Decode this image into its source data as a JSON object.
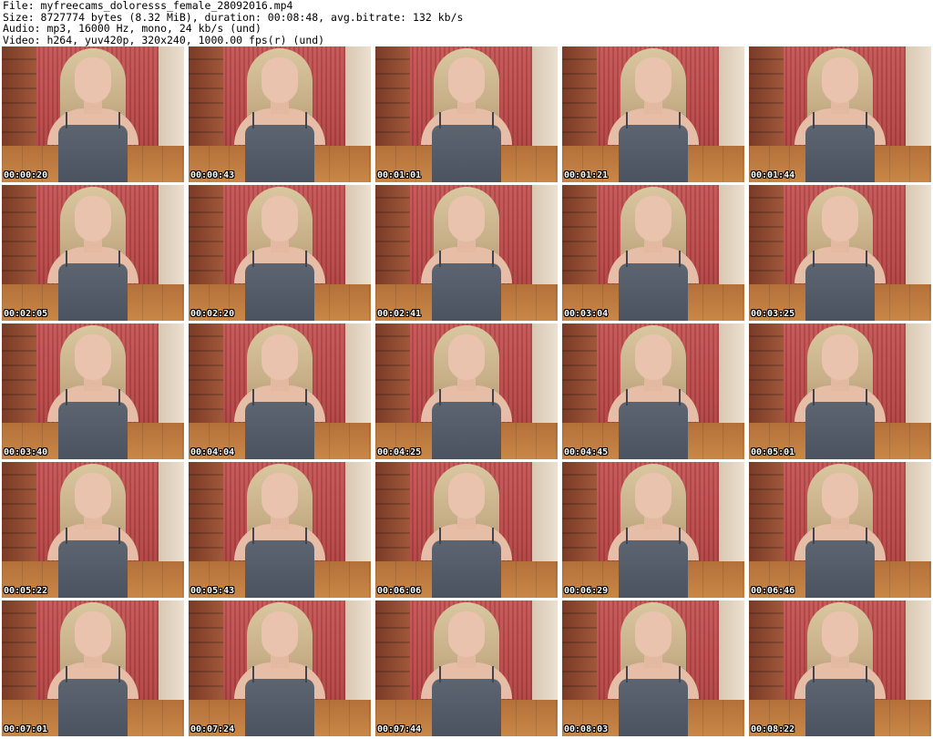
{
  "header": {
    "file_line": "File: myfreecams_doloresss_female_28092016.mp4",
    "size_line": "Size: 8727774 bytes (8.32 MiB), duration: 00:08:48, avg.bitrate: 132 kb/s",
    "audio_line": "Audio: mp3, 16000 Hz, mono, 24 kb/s (und)",
    "video_line": "Video: h264, yuv420p, 320x240, 1000.00 fps(r) (und)"
  },
  "thumbnails": [
    {
      "timestamp": "00:00:20"
    },
    {
      "timestamp": "00:00:43"
    },
    {
      "timestamp": "00:01:01"
    },
    {
      "timestamp": "00:01:21"
    },
    {
      "timestamp": "00:01:44"
    },
    {
      "timestamp": "00:02:05"
    },
    {
      "timestamp": "00:02:20"
    },
    {
      "timestamp": "00:02:41"
    },
    {
      "timestamp": "00:03:04"
    },
    {
      "timestamp": "00:03:25"
    },
    {
      "timestamp": "00:03:40"
    },
    {
      "timestamp": "00:04:04"
    },
    {
      "timestamp": "00:04:25"
    },
    {
      "timestamp": "00:04:45"
    },
    {
      "timestamp": "00:05:01"
    },
    {
      "timestamp": "00:05:22"
    },
    {
      "timestamp": "00:05:43"
    },
    {
      "timestamp": "00:06:06"
    },
    {
      "timestamp": "00:06:29"
    },
    {
      "timestamp": "00:06:46"
    },
    {
      "timestamp": "00:07:01"
    },
    {
      "timestamp": "00:07:24"
    },
    {
      "timestamp": "00:07:44"
    },
    {
      "timestamp": "00:08:03"
    },
    {
      "timestamp": "00:08:22"
    }
  ]
}
